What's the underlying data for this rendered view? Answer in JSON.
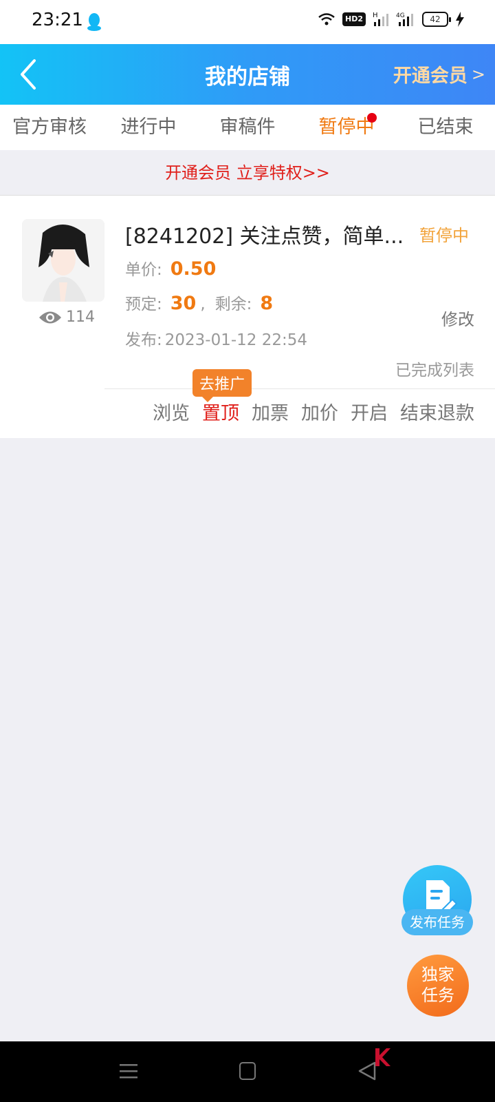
{
  "status_bar": {
    "time": "23:21",
    "battery": "42",
    "icons": [
      "qq-icon",
      "wifi-icon",
      "hd-icon",
      "signal-h-icon",
      "signal-4g-icon",
      "battery-icon",
      "charging-icon"
    ],
    "hd_label": "HD2",
    "h_label": "H",
    "g4_label": "4G"
  },
  "header": {
    "title": "我的店铺",
    "vip_label": "开通会员",
    "vip_chevron": ">"
  },
  "tabs": [
    {
      "label": "官方审核",
      "active": false
    },
    {
      "label": "进行中",
      "active": false
    },
    {
      "label": "审稿件",
      "active": false
    },
    {
      "label": "暂停中",
      "active": true,
      "has_dot": true
    },
    {
      "label": "已结束",
      "active": false
    }
  ],
  "banner": {
    "text": "开通会员 立享特权>>"
  },
  "task": {
    "title": "[8241202] 关注点赞，简单...",
    "status": "暂停中",
    "views": "114",
    "price_label": "单价:",
    "price": "0.50",
    "booked_label": "预定:",
    "booked": "30",
    "separator": ",",
    "remaining_label": "剩余:",
    "remaining": "8",
    "publish_label": "发布:",
    "publish_date": "2023-01-12 22:54",
    "edit_label": "修改",
    "completed_label": "已完成列表",
    "promote_tip": "去推广",
    "actions": [
      "浏览",
      "置顶",
      "加票",
      "加价",
      "开启",
      "结束退款"
    ]
  },
  "fab": {
    "publish_label": "发布任务",
    "exclusive_line1": "独家",
    "exclusive_line2": "任务"
  },
  "colors": {
    "header_gradient_start": "#13c3f6",
    "header_gradient_end": "#3e86f6",
    "accent_orange": "#f07a12",
    "accent_red": "#e0201b",
    "background": "#efeff4"
  }
}
